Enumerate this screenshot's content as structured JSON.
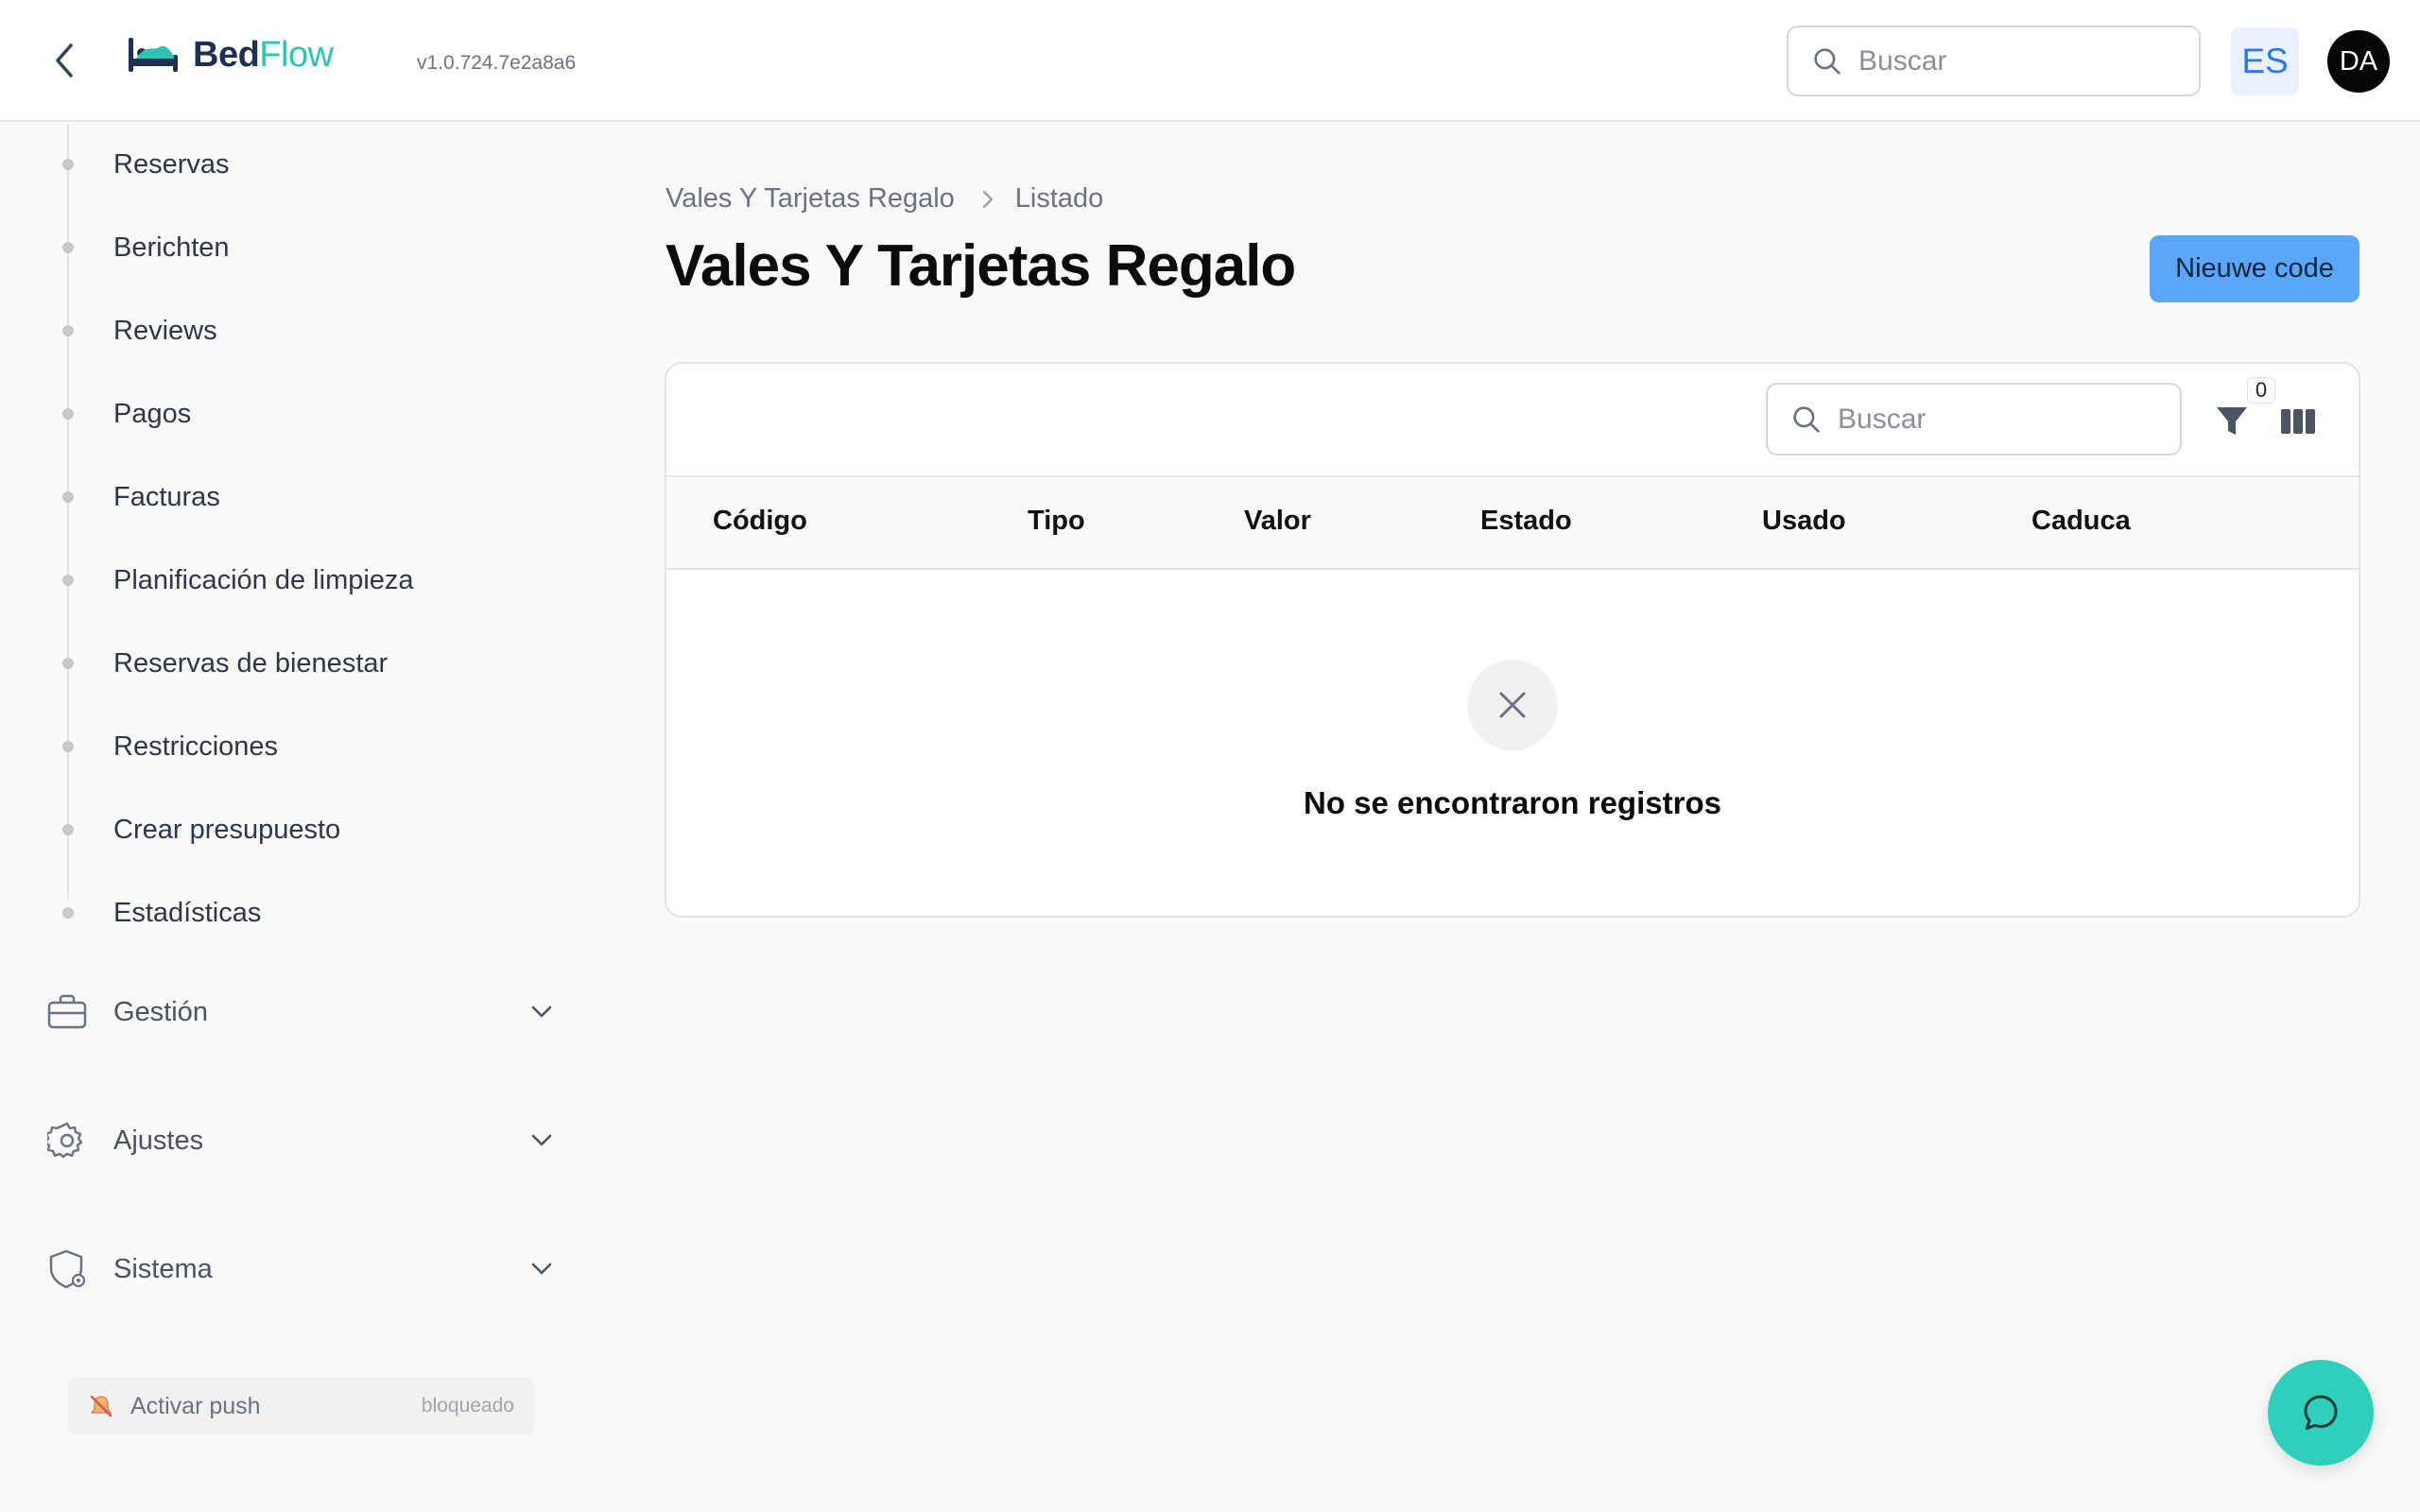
{
  "header": {
    "back_icon": "chevron-left-icon",
    "logo_part1": "Bed",
    "logo_part2": "Flow",
    "version": "v1.0.724.7e2a8a6",
    "search_placeholder": "Buscar",
    "language": "ES",
    "user_initials": "DA"
  },
  "sidebar": {
    "sub_items": [
      {
        "label": "Reservas"
      },
      {
        "label": "Berichten"
      },
      {
        "label": "Reviews"
      },
      {
        "label": "Pagos"
      },
      {
        "label": "Facturas"
      },
      {
        "label": "Planificación de limpieza"
      },
      {
        "label": "Reservas de bienestar"
      },
      {
        "label": "Restricciones"
      },
      {
        "label": "Crear presupuesto"
      },
      {
        "label": "Estadísticas"
      }
    ],
    "groups": [
      {
        "label": "Gestión",
        "icon": "briefcase-icon"
      },
      {
        "label": "Ajustes",
        "icon": "gear-icon"
      },
      {
        "label": "Sistema",
        "icon": "shield-gear-icon"
      }
    ],
    "push": {
      "label": "Activar push",
      "status": "bloqueado",
      "icon": "bell-off-icon"
    }
  },
  "main": {
    "breadcrumb": [
      "Vales Y Tarjetas Regalo",
      "Listado"
    ],
    "title": "Vales Y Tarjetas Regalo",
    "new_button": "Nieuwe code",
    "table": {
      "search_placeholder": "Buscar",
      "filter_count": "0",
      "columns": [
        "Código",
        "Tipo",
        "Valor",
        "Estado",
        "Usado",
        "Caduca"
      ],
      "rows": [],
      "empty_message": "No se encontraron registros"
    }
  },
  "colors": {
    "accent": "#5aa6f8",
    "brand_dark": "#1e2f52",
    "brand_teal": "#2cc4b5",
    "chat": "#2fd0bb"
  }
}
